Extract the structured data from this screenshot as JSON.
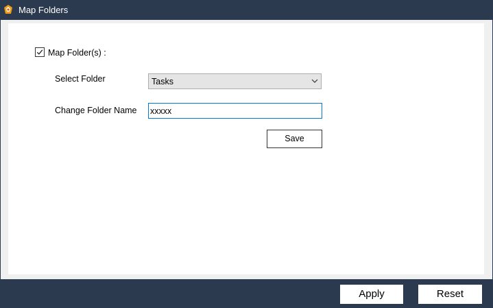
{
  "window": {
    "title": "Map Folders",
    "icon": "app-logo-icon"
  },
  "form": {
    "map_folders_checked": true,
    "map_folders_label": "Map Folder(s) :",
    "select_folder_label": "Select Folder",
    "select_folder_value": "Tasks",
    "change_folder_name_label": "Change Folder Name",
    "change_folder_name_value": "xxxxx",
    "save_label": "Save"
  },
  "footer": {
    "apply_label": "Apply",
    "reset_label": "Reset"
  },
  "colors": {
    "titlebar_bg": "#2b3a4f",
    "focus_border": "#0078d7",
    "panel_bg": "#ffffff"
  }
}
